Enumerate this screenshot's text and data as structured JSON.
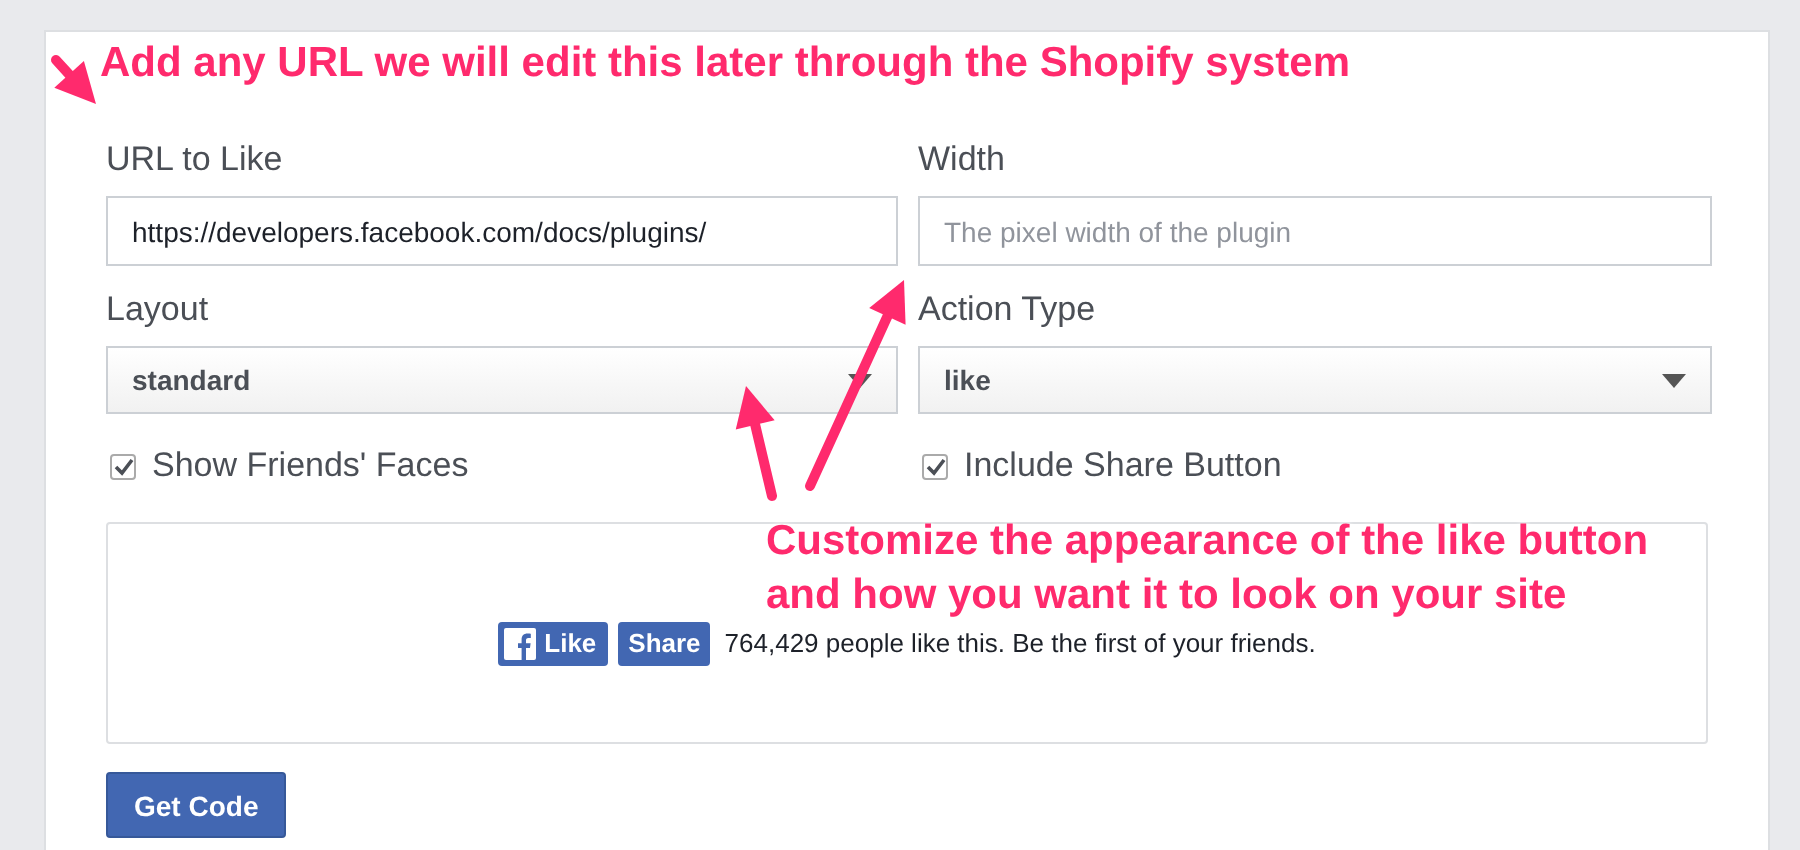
{
  "fields": [
    {
      "kind": "text",
      "label": "URL to Like",
      "value": "https://developers.facebook.com/docs/plugins/"
    },
    {
      "kind": "text",
      "label": "Width",
      "placeholder": "The pixel width of the plugin"
    },
    {
      "kind": "select",
      "label": "Layout",
      "value": "standard"
    },
    {
      "kind": "select",
      "label": "Action Type",
      "value": "like"
    }
  ],
  "checkboxes": [
    {
      "label": "Show Friends' Faces",
      "checked": true
    },
    {
      "label": "Include Share Button",
      "checked": true
    }
  ],
  "preview": {
    "like_button": "Like",
    "share_button": "Share",
    "social_text": "764,429 people like this. Be the first of your friends."
  },
  "get_code_button": "Get Code",
  "annotations": [
    {
      "lines": [
        "Add any URL we will edit this later through the Shopify system"
      ]
    },
    {
      "lines": [
        "Customize the appearance of the like button",
        "and how you want it to look on your site"
      ]
    }
  ]
}
